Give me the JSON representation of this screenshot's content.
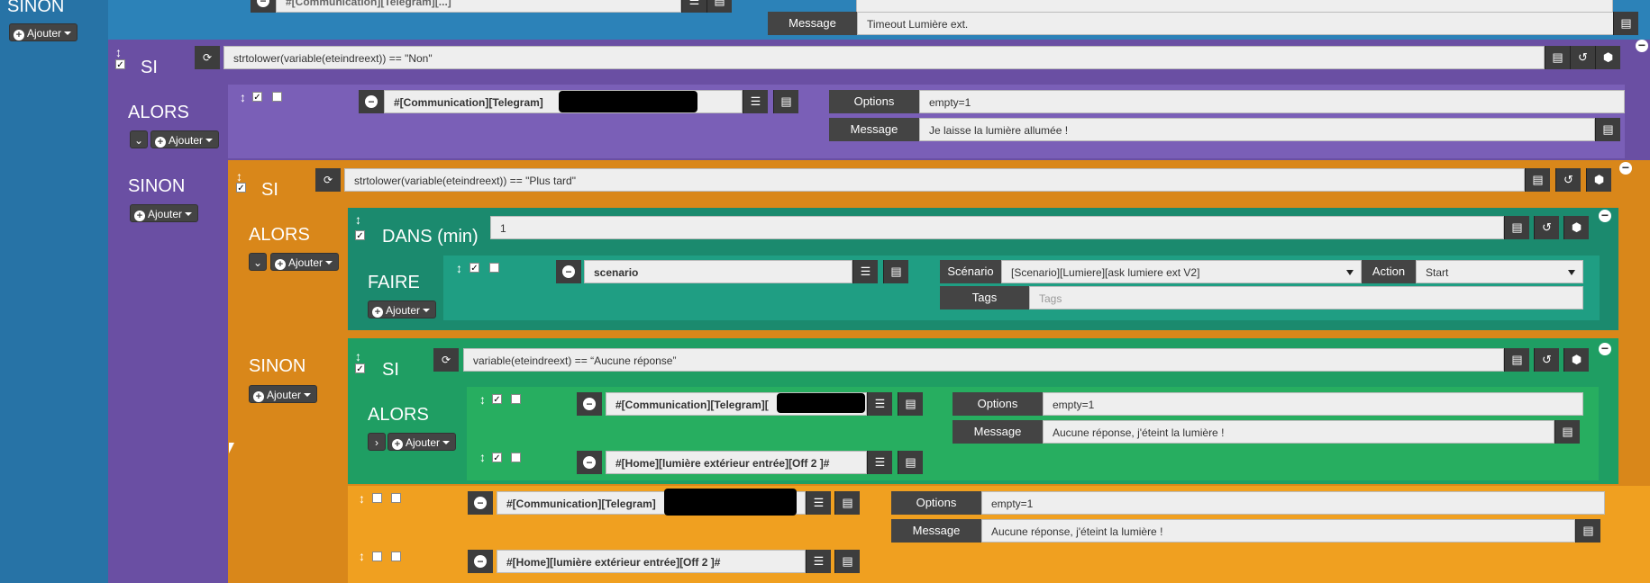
{
  "top": {
    "sinon_label": "SINON",
    "ajouter_label": "Ajouter",
    "cmd_partial": "#[Communication][Telegram][...]",
    "message_label": "Message",
    "message_value": "Timeout Lumière ext."
  },
  "si1": {
    "si_label": "SI",
    "condition": "strtolower(variable(eteindreext)) == \"Non\"",
    "alors_label": "ALORS",
    "ajouter_label": "Ajouter",
    "command": "#[Communication][Telegram]",
    "options_label": "Options",
    "options_value": "empty=1",
    "message_label": "Message",
    "message_value": "Je laisse la lumière allumée !",
    "sinon_label": "SINON"
  },
  "si2": {
    "si_label": "SI",
    "condition": "strtolower(variable(eteindreext)) == \"Plus tard\"",
    "alors_label": "ALORS",
    "ajouter_label": "Ajouter",
    "dans_label": "DANS (min)",
    "dans_value": "1",
    "faire_label": "FAIRE",
    "scenario_cmd": "scenario",
    "scenario_label": "Scénario",
    "scenario_value": "[Scenario][Lumiere][ask lumiere ext V2]",
    "action_label": "Action",
    "action_value": "Start",
    "tags_label": "Tags",
    "tags_placeholder": "Tags",
    "sinon_label": "SINON"
  },
  "si3": {
    "si_label": "SI",
    "condition": "variable(eteindreext) == “Aucune réponse”",
    "alors_label": "ALORS",
    "ajouter_label": "Ajouter",
    "command1": "#[Communication][Telegram][",
    "options_label": "Options",
    "options_value": "empty=1",
    "message_label": "Message",
    "message_value": "Aucune réponse, j'éteint la lumière !",
    "command2": "#[Home][lumière  extérieur entrée][Off 2 ]#"
  },
  "bottom": {
    "command1": "#[Communication][Telegram]",
    "options_label": "Options",
    "options_value": "empty=1",
    "message_label": "Message",
    "message_value": "Aucune réponse, j'éteint la lumière !",
    "command2": "#[Home][lumière  extérieur entrée][Off 2 ]#"
  }
}
